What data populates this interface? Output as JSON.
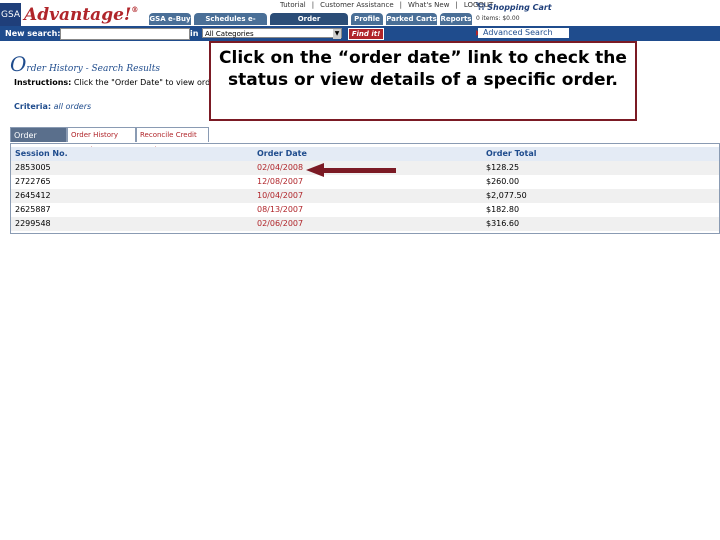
{
  "logo": {
    "gsa": "GSA",
    "name": "Advantage!",
    "reg": "®"
  },
  "top_links": {
    "tutorial": "Tutorial",
    "customer_assistance": "Customer Assistance",
    "whats_new": "What's New",
    "logout": "LOGOUT"
  },
  "cart": {
    "title": "Shopping Cart",
    "summary": "0 items: $0.00"
  },
  "nav_tabs": [
    "GSA e-Buy",
    "Schedules e-Library",
    "Order History/Status",
    "Profile",
    "Parked Carts",
    "Reports"
  ],
  "search": {
    "label": "New search:",
    "value": "",
    "in_label": "in",
    "category": "All Categories",
    "find_label": "Find it!",
    "advanced": "Advanced Search"
  },
  "page": {
    "title_initial": "O",
    "title_rest": "rder History - Search Results",
    "instructions_label": "Instructions:",
    "instructions_text": " Click the \"Order Date\" to view order",
    "criteria_label": "Criteria:",
    "criteria_value": "all orders"
  },
  "callout": {
    "text": "Click on the “order date” link to check the status or view details of a specific order."
  },
  "subtabs": [
    "Order Results",
    "Order History Search",
    "Reconcile Credit Card"
  ],
  "table": {
    "headers": [
      "Session No.",
      "Order Date",
      "Order Total"
    ],
    "rows": [
      {
        "session": "2853005",
        "date": "02/04/2008",
        "total": "$128.25"
      },
      {
        "session": "2722765",
        "date": "12/08/2007",
        "total": "$260.00"
      },
      {
        "session": "2645412",
        "date": "10/04/2007",
        "total": "$2,077.50"
      },
      {
        "session": "2625887",
        "date": "08/13/2007",
        "total": "$182.80"
      },
      {
        "session": "2299548",
        "date": "02/06/2007",
        "total": "$316.60"
      }
    ]
  },
  "colors": {
    "brand_red": "#b0252a",
    "nav_blue": "#1f4c8d",
    "callout_border": "#7b1a24"
  },
  "icons": {
    "cart": "shopping-cart-icon",
    "arrow": "left-arrow-icon"
  }
}
